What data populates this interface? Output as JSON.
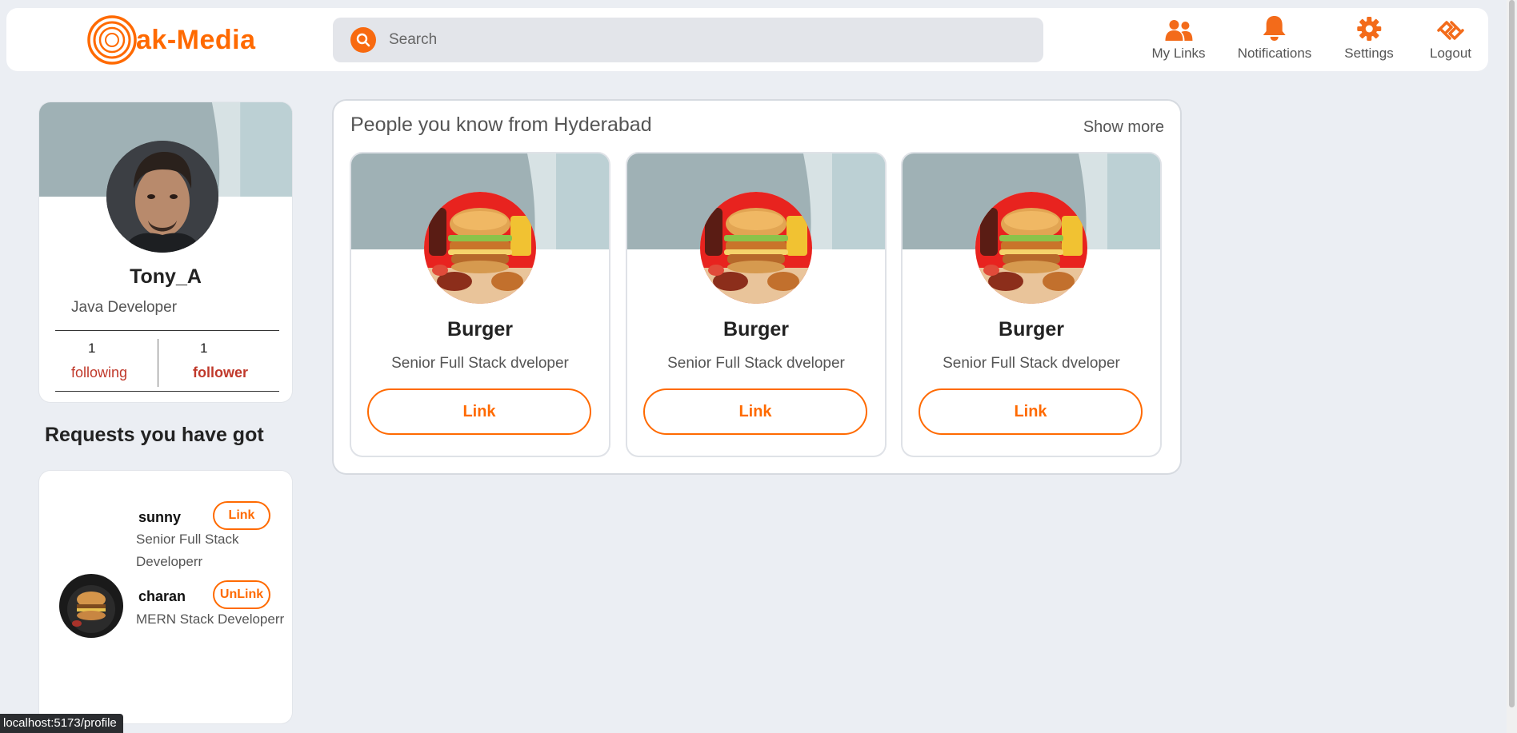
{
  "brand": {
    "logo_text": "ak-Media",
    "accent": "#ff6a00"
  },
  "search": {
    "placeholder": "Search"
  },
  "nav": {
    "items": [
      {
        "label": "My Links",
        "icon": "users-icon"
      },
      {
        "label": "Notifications",
        "icon": "bell-icon"
      },
      {
        "label": "Settings",
        "icon": "gear-icon"
      },
      {
        "label": "Logout",
        "icon": "logout-icon"
      }
    ]
  },
  "profile": {
    "name": "Tony_A",
    "role": "Java Developer",
    "following_count": "1",
    "following_label": "following",
    "follower_count": "1",
    "follower_label": "follower"
  },
  "requests": {
    "title": "Requests you have got",
    "items": [
      {
        "name": "sunny",
        "role_line1": "Senior Full Stack",
        "role_line2": "Developerr",
        "action": "Link"
      },
      {
        "name": "charan",
        "role_line1": "MERN Stack Developerr",
        "action": "UnLink"
      }
    ]
  },
  "people": {
    "title": "People you know from Hyderabad",
    "show_more": "Show more",
    "cards": [
      {
        "name": "Burger",
        "role": "Senior Full Stack dveloper",
        "action": "Link"
      },
      {
        "name": "Burger",
        "role": "Senior Full Stack dveloper",
        "action": "Link"
      },
      {
        "name": "Burger",
        "role": "Senior Full Stack dveloper",
        "action": "Link"
      }
    ]
  },
  "status_bar": {
    "url": "localhost:5173/profile"
  }
}
